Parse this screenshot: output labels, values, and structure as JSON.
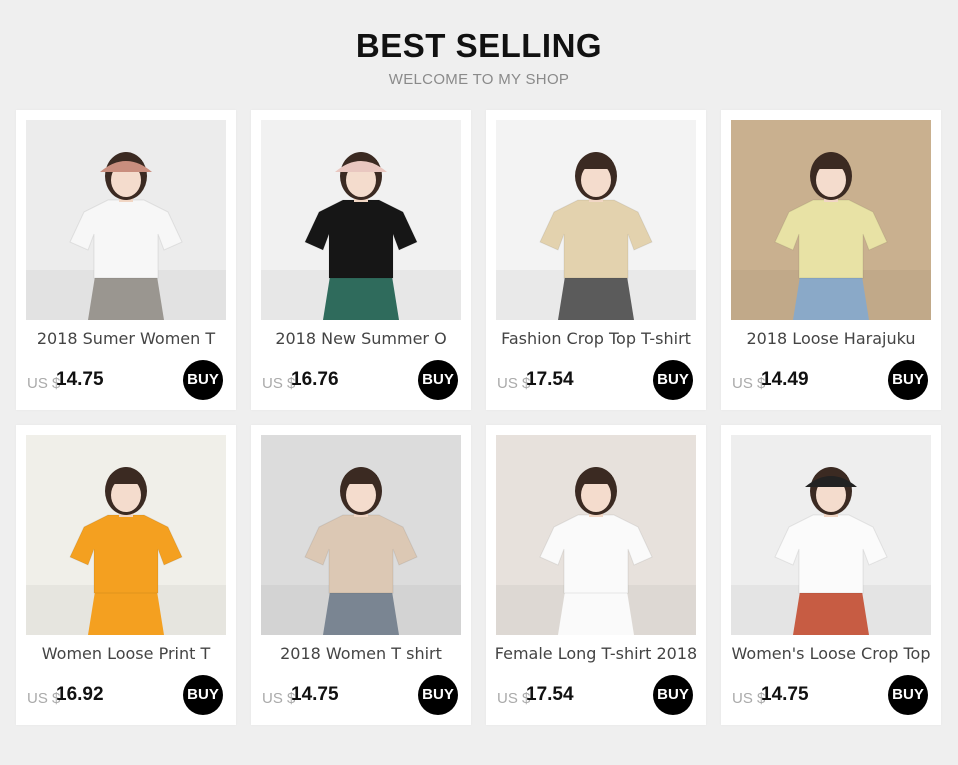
{
  "header": {
    "title": "BEST SELLING",
    "subtitle": "WELCOME TO MY SHOP"
  },
  "currency": "US $",
  "buy_label": "BUY",
  "products": [
    {
      "name": "2018 Sumer Women T",
      "price": "14.75",
      "shirt_color": "#f7f7f7",
      "bottom_color": "#9a9690",
      "bg_color": "#ececec",
      "hat_color": "#c98e7e"
    },
    {
      "name": "2018 New Summer O",
      "price": "16.76",
      "shirt_color": "#161616",
      "bottom_color": "#2f6b5c",
      "bg_color": "#f1f1f1",
      "hat_color": "#e9c7c0"
    },
    {
      "name": "Fashion Crop Top T-shirt",
      "price": "17.54",
      "shirt_color": "#e3d2ae",
      "bottom_color": "#5b5b5b",
      "bg_color": "#f3f3f3",
      "hat_color": ""
    },
    {
      "name": "2018 Loose Harajuku",
      "price": "14.49",
      "shirt_color": "#e8e2a5",
      "bottom_color": "#8aa9c8",
      "bg_color": "#c9b08f",
      "hat_color": ""
    },
    {
      "name": "Women Loose Print T",
      "price": "16.92",
      "shirt_color": "#f4a020",
      "bottom_color": "#f4a020",
      "bg_color": "#f0efe9",
      "hat_color": ""
    },
    {
      "name": "2018 Women T shirt",
      "price": "14.75",
      "shirt_color": "#dcc8b4",
      "bottom_color": "#7a8592",
      "bg_color": "#dcdcdc",
      "hat_color": ""
    },
    {
      "name": "Female Long T-shirt 2018",
      "price": "17.54",
      "shirt_color": "#fafafa",
      "bottom_color": "#fafafa",
      "bg_color": "#e7e1dc",
      "hat_color": ""
    },
    {
      "name": "Women's Loose Crop Top",
      "price": "14.75",
      "shirt_color": "#fbfbfb",
      "bottom_color": "#c75c43",
      "bg_color": "#eeeeee",
      "hat_color": "#222222"
    }
  ]
}
